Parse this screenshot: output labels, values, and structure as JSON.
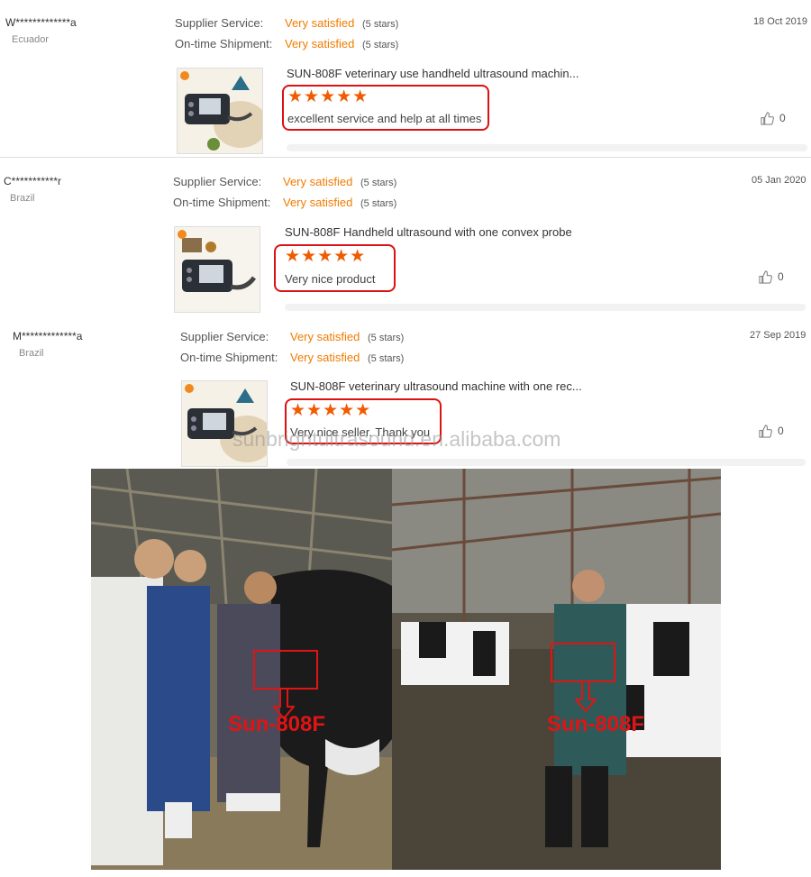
{
  "labels": {
    "supplier_service": "Supplier Service:",
    "ontime_shipment": "On-time Shipment:",
    "stars_text": "(5 stars)",
    "stars_glyphs": "★★★★★"
  },
  "reviews": [
    {
      "buyer": "W*************a",
      "country": "Ecuador",
      "date": "18 Oct 2019",
      "supplier_service": "Very satisfied",
      "ontime_shipment": "Very satisfied",
      "product_title": "SUN-808F veterinary use handheld ultrasound machin...",
      "rating": 5,
      "feedback": "excellent service and help at all times",
      "likes": "0"
    },
    {
      "buyer": "C***********r",
      "country": "Brazil",
      "date": "05 Jan 2020",
      "supplier_service": "Very satisfied",
      "ontime_shipment": "Very satisfied",
      "product_title": "SUN-808F Handheld ultrasound with one convex probe",
      "rating": 5,
      "feedback": "Very nice product",
      "likes": "0"
    },
    {
      "buyer": "M*************a",
      "country": "Brazil",
      "date": "27 Sep 2019",
      "supplier_service": "Very satisfied",
      "ontime_shipment": "Very satisfied",
      "product_title": "SUN-808F veterinary ultrasound machine with one rec...",
      "rating": 5,
      "feedback": "Very nice seller. Thank you",
      "likes": "0"
    }
  ],
  "watermark": "sunbrightultrasound.en.alibaba.com",
  "photos": [
    {
      "label": "Sun-808F"
    },
    {
      "label": "Sun-808F"
    }
  ],
  "colors": {
    "accent": "#f07c00",
    "star": "#f05a00",
    "highlight": "#dd1111"
  }
}
